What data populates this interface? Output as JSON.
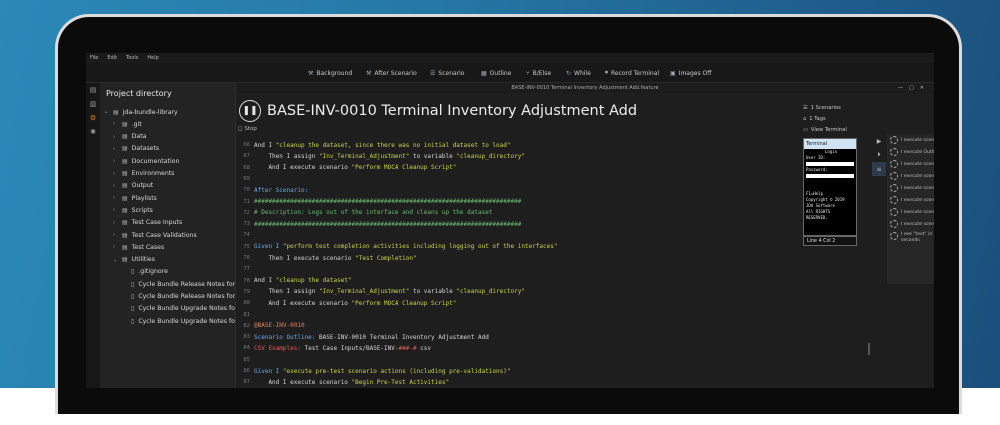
{
  "menubar": [
    "File",
    "Edit",
    "Tools",
    "Help"
  ],
  "toolbar": [
    {
      "label": "Background",
      "icon": "wrench-icon"
    },
    {
      "label": "After Scenario",
      "icon": "wrench-icon"
    },
    {
      "label": "Scenario",
      "icon": "list-icon"
    },
    {
      "label": "Outline",
      "icon": "grid-icon"
    },
    {
      "label": "B/Else",
      "icon": "branch-icon"
    },
    {
      "label": "While",
      "icon": "loop-icon"
    },
    {
      "label": "Record Terminal",
      "icon": "record-icon"
    },
    {
      "label": "Images Off",
      "icon": "image-icon"
    }
  ],
  "window_title": "BASE-INV-0010 Terminal Inventory Adjustment Add.feature",
  "sidebar": {
    "title": "Project directory",
    "items": [
      {
        "label": "jda-bundle-library",
        "indent": 0,
        "chev": "⌄"
      },
      {
        "label": ".git",
        "indent": 1,
        "chev": "›"
      },
      {
        "label": "Data",
        "indent": 1,
        "chev": "›"
      },
      {
        "label": "Datasets",
        "indent": 1,
        "chev": "›"
      },
      {
        "label": "Documentation",
        "indent": 1,
        "chev": "›"
      },
      {
        "label": "Environments",
        "indent": 1,
        "chev": "›"
      },
      {
        "label": "Output",
        "indent": 1,
        "chev": "›"
      },
      {
        "label": "Playlists",
        "indent": 1,
        "chev": "›"
      },
      {
        "label": "Scripts",
        "indent": 1,
        "chev": "›"
      },
      {
        "label": "Test Case Inputs",
        "indent": 1,
        "chev": "›"
      },
      {
        "label": "Test Case Validations",
        "indent": 1,
        "chev": "›"
      },
      {
        "label": "Test Cases",
        "indent": 1,
        "chev": "›"
      },
      {
        "label": "Utilities",
        "indent": 1,
        "chev": "⌄"
      },
      {
        "label": ".gitignore",
        "indent": 2,
        "chev": ""
      },
      {
        "label": "Cycle Bundle Release Notes for Blu",
        "indent": 2,
        "chev": ""
      },
      {
        "label": "Cycle Bundle Release Notes for Blu",
        "indent": 2,
        "chev": ""
      },
      {
        "label": "Cycle Bundle Upgrade Notes for Bl",
        "indent": 2,
        "chev": ""
      },
      {
        "label": "Cycle Bundle Upgrade Notes for Bl",
        "indent": 2,
        "chev": ""
      }
    ]
  },
  "editor": {
    "title": "BASE-INV-0010 Terminal Inventory Adjustment Add",
    "stop_label": "Stop",
    "lines": [
      {
        "n": "66",
        "parts": [
          {
            "t": "And I ",
            "c": "c-white"
          },
          {
            "t": "\"cleanup the dataset, since there was no initial dataset to load\"",
            "c": "c-string"
          }
        ]
      },
      {
        "n": "67",
        "parts": [
          {
            "t": "    Then I assign ",
            "c": "c-white"
          },
          {
            "t": "\"Inv_Terminal_Adjustment\"",
            "c": "c-string"
          },
          {
            "t": " to variable ",
            "c": "c-white"
          },
          {
            "t": "\"cleanup_directory\"",
            "c": "c-string"
          }
        ]
      },
      {
        "n": "68",
        "parts": [
          {
            "t": "    And I execute scenario ",
            "c": "c-white"
          },
          {
            "t": "\"Perform MOCA Cleanup Script\"",
            "c": "c-string"
          }
        ]
      },
      {
        "n": "69",
        "parts": []
      },
      {
        "n": "70",
        "parts": [
          {
            "t": "After Scenario:",
            "c": "c-blue"
          }
        ]
      },
      {
        "n": "71",
        "parts": [
          {
            "t": "##########################################################################",
            "c": "c-green"
          }
        ]
      },
      {
        "n": "72",
        "parts": [
          {
            "t": "# Description: Logs out of the interface and cleans up the dataset",
            "c": "c-green"
          }
        ]
      },
      {
        "n": "73",
        "parts": [
          {
            "t": "##########################################################################",
            "c": "c-green"
          }
        ]
      },
      {
        "n": "74",
        "parts": []
      },
      {
        "n": "75",
        "parts": [
          {
            "t": "Given I ",
            "c": "c-blue"
          },
          {
            "t": "\"perform test completion activities including logging out of the interfaces\"",
            "c": "c-string"
          }
        ]
      },
      {
        "n": "76",
        "parts": [
          {
            "t": "    Then I execute scenario ",
            "c": "c-white"
          },
          {
            "t": "\"Test Completion\"",
            "c": "c-string"
          }
        ]
      },
      {
        "n": "77",
        "parts": []
      },
      {
        "n": "78",
        "parts": [
          {
            "t": "And I ",
            "c": "c-white"
          },
          {
            "t": "\"cleanup the dataset\"",
            "c": "c-string"
          }
        ]
      },
      {
        "n": "79",
        "parts": [
          {
            "t": "    Then I assign ",
            "c": "c-white"
          },
          {
            "t": "\"Inv_Terminal_Adjustment\"",
            "c": "c-string"
          },
          {
            "t": " to variable ",
            "c": "c-white"
          },
          {
            "t": "\"cleanup_directory\"",
            "c": "c-string"
          }
        ]
      },
      {
        "n": "80",
        "parts": [
          {
            "t": "    And I execute scenario ",
            "c": "c-white"
          },
          {
            "t": "\"Perform MOCA Cleanup Script\"",
            "c": "c-string"
          }
        ]
      },
      {
        "n": "81",
        "parts": []
      },
      {
        "n": "82",
        "parts": [
          {
            "t": "@BASE-INV-0010",
            "c": "c-orange"
          }
        ]
      },
      {
        "n": "83",
        "parts": [
          {
            "t": "Scenario Outline: ",
            "c": "c-blue"
          },
          {
            "t": "BASE-INV-0010 Terminal Inventory Adjustment Add",
            "c": "c-white"
          }
        ]
      },
      {
        "n": "84",
        "parts": [
          {
            "t": "CSV Examples: ",
            "c": "c-red"
          },
          {
            "t": "Test Case Inputs/BASE-INV-",
            "c": "c-white"
          },
          {
            "t": "###-#",
            "c": "c-red"
          },
          {
            "t": " csv",
            "c": "c-white"
          }
        ]
      },
      {
        "n": "85",
        "parts": []
      },
      {
        "n": "86",
        "parts": [
          {
            "t": "Given I ",
            "c": "c-blue"
          },
          {
            "t": "\"execute pre-test scenario actions (including pre-validations)\"",
            "c": "c-string"
          }
        ]
      },
      {
        "n": "87",
        "parts": [
          {
            "t": "    And I execute scenario ",
            "c": "c-white"
          },
          {
            "t": "\"Begin Pre-Test Activities\"",
            "c": "c-string"
          }
        ]
      }
    ]
  },
  "terminal_links": [
    "1 Scenarios",
    "1 Tags",
    "View Terminal"
  ],
  "terminal": {
    "header": "Terminal",
    "lines": [
      "Login",
      "User ID:",
      "",
      "Password:",
      "",
      "",
      "",
      "F1=Help",
      "Copyright © 2019",
      "JDA Software",
      "All RIGHTS",
      "RESERVED."
    ],
    "status": "Line 4 Col 2"
  },
  "right_panel": [
    "I execute scenario \"BASE-INV-0010 Terminal Inventory Adjustment Add\"",
    "I execute Outline \"BASE-INV-0010 Terminal Inventory Adjustment Add\"",
    "I execute scenario \"Terminal Login\"",
    "I execute scenario \"Terminal Login\"",
    "I execute scenario \"Check For Login Screen\"",
    "I execute scenario \"Check For Login Screen\"",
    "I execute scenario \"Check For User Logged In\"",
    "I execute scenario \"Check For User Login\""
  ],
  "right_panel_last": "I see \"text\" in terminal within \"cfg_timeout\" seconds",
  "window_controls": [
    "—",
    "□",
    "✕"
  ]
}
